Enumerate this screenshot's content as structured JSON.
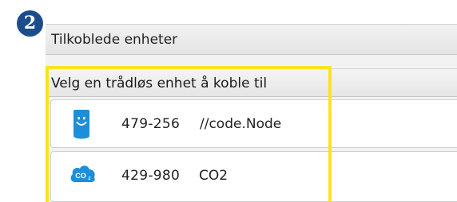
{
  "step": {
    "number": "2",
    "color": "#1c4c8c"
  },
  "panel": {
    "title": "Tilkoblede enheter"
  },
  "section": {
    "label": "Velg en trådløs enhet å koble til"
  },
  "devices": [
    {
      "id": "479-256",
      "name": "//code.Node",
      "icon": "code-node-icon"
    },
    {
      "id": "429-980",
      "name": "CO2",
      "icon": "co2-cloud-icon"
    }
  ],
  "colors": {
    "highlight": "#ffe21f",
    "icon_blue": "#1d8fd8"
  }
}
